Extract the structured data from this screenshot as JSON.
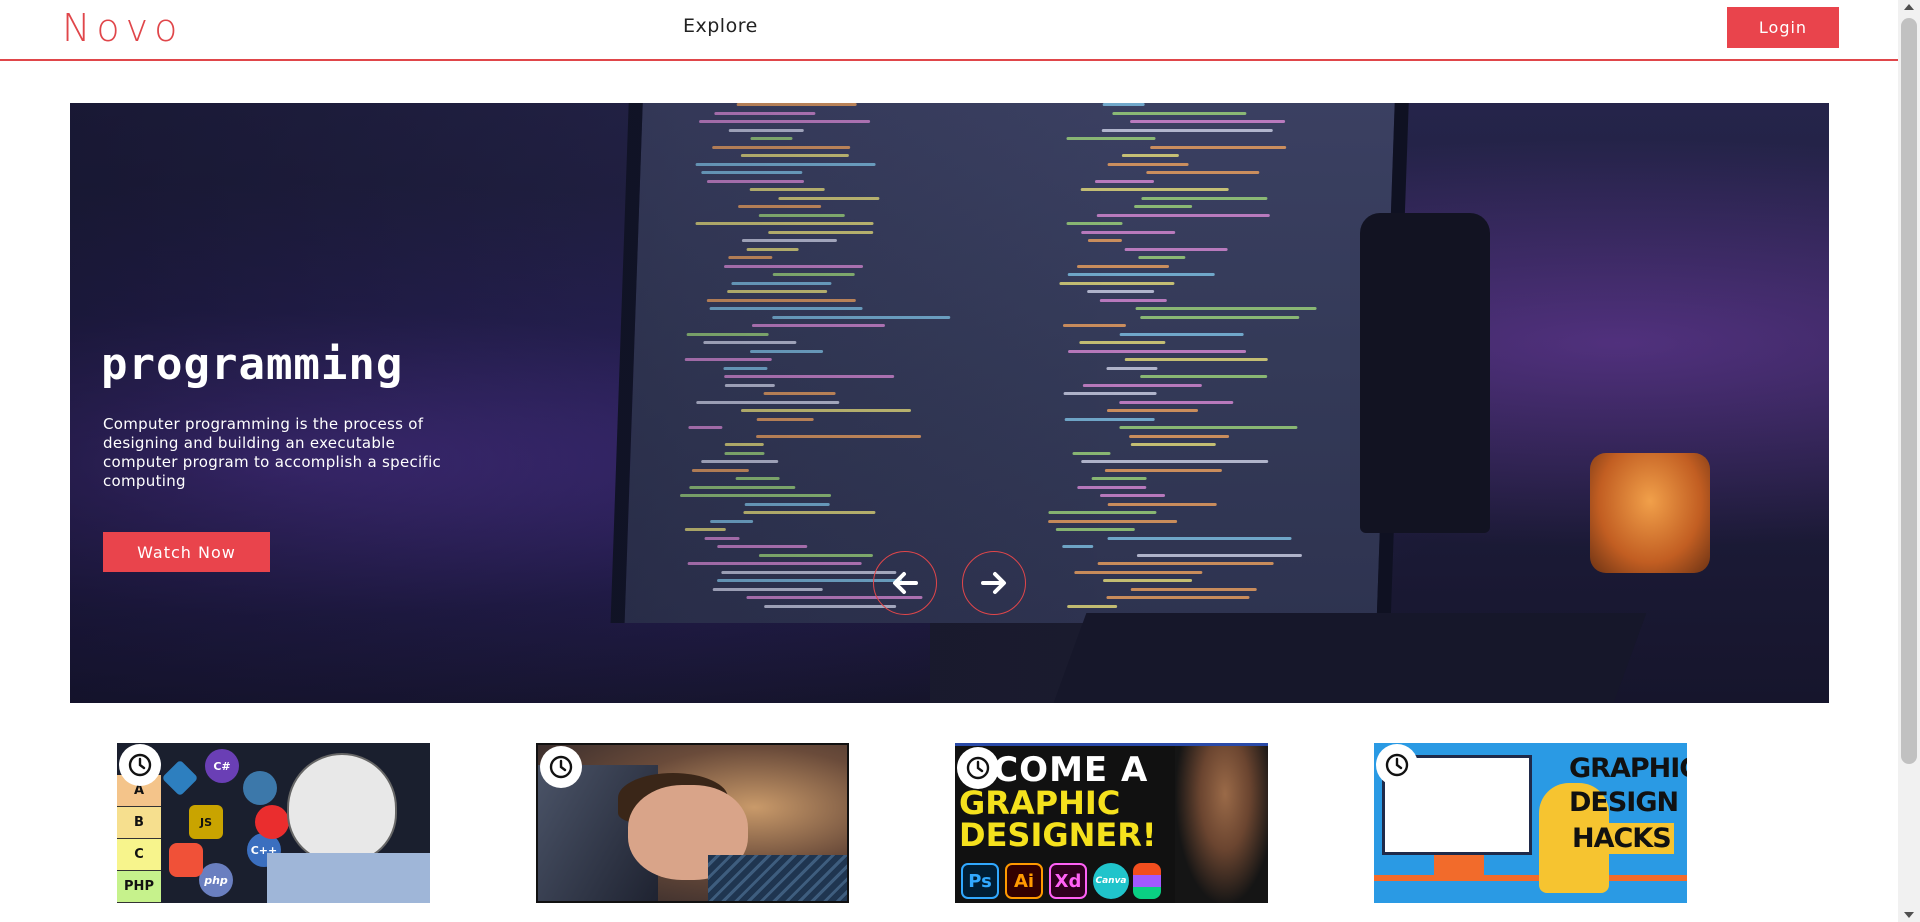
{
  "header": {
    "logo": "Novo",
    "nav": {
      "explore_label": "Explore"
    },
    "login_label": "Login"
  },
  "hero": {
    "title": "programming",
    "description": "Computer programming is the process of designing and building an executable computer program to accomplish a specific computing",
    "cta_label": "Watch Now",
    "prev_icon": "arrow-left-icon",
    "next_icon": "arrow-right-icon"
  },
  "thumbnails": [
    {
      "icon": "clock-icon",
      "tiers": [
        "A",
        "B",
        "C",
        "PHP"
      ],
      "languages": [
        "C#",
        "JS",
        "C++",
        "php"
      ]
    },
    {
      "icon": "clock-icon"
    },
    {
      "icon": "clock-icon",
      "lines": [
        "ECOME A",
        "GRAPHIC",
        "DESIGNER!"
      ],
      "apps": [
        "Ps",
        "Ai",
        "Xd",
        "Canva"
      ]
    },
    {
      "icon": "clock-icon",
      "lines": [
        "GRAPHIC",
        "DESIGN",
        "HACKS"
      ]
    }
  ],
  "colors": {
    "accent": "#e9444c",
    "header_border": "#e0464a"
  }
}
